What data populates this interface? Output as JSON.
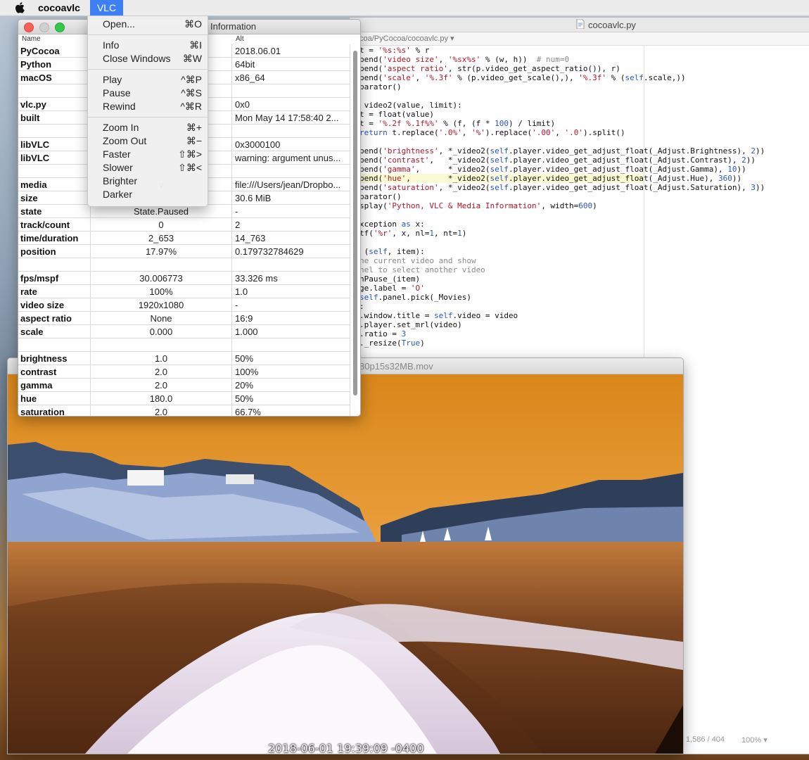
{
  "menubar": {
    "app_name": "cocoavlc",
    "active_menu": "VLC"
  },
  "vlc_menu": {
    "groups": [
      [
        {
          "label": "Open...",
          "shortcut": "⌘O"
        }
      ],
      [
        {
          "label": "Info",
          "shortcut": "⌘I"
        },
        {
          "label": "Close Windows",
          "shortcut": "⌘W"
        }
      ],
      [
        {
          "label": "Play",
          "shortcut": "^⌘P"
        },
        {
          "label": "Pause",
          "shortcut": "^⌘S"
        },
        {
          "label": "Rewind",
          "shortcut": "^⌘R"
        }
      ],
      [
        {
          "label": "Zoom In",
          "shortcut": "⌘+"
        },
        {
          "label": "Zoom Out",
          "shortcut": "⌘−"
        },
        {
          "label": "Faster",
          "shortcut": "⇧⌘>"
        },
        {
          "label": "Slower",
          "shortcut": "⇧⌘<"
        },
        {
          "label": "Brighter",
          "shortcut": ""
        },
        {
          "label": "Darker",
          "shortcut": ""
        }
      ]
    ]
  },
  "info_window": {
    "title": "Information",
    "columns": {
      "name": "Name",
      "alt": "Alt"
    },
    "rows": [
      [
        "PyCocoa",
        "",
        "2018.06.01"
      ],
      [
        "Python",
        "",
        "64bit"
      ],
      [
        "macOS",
        "",
        "x86_64"
      ],
      [
        "",
        "",
        ""
      ],
      [
        "vlc.py",
        "",
        "0x0"
      ],
      [
        "built",
        "",
        "Mon May 14 17:58:40 2..."
      ],
      [
        "",
        "",
        ""
      ],
      [
        "libVLC",
        "",
        "0x3000100"
      ],
      [
        "libVLC",
        "",
        "warning: argument unus..."
      ],
      [
        "",
        "",
        ""
      ],
      [
        "media",
        "v",
        "file:///Users/jean/Dropbo..."
      ],
      [
        "size",
        "",
        "30.6 MiB"
      ],
      [
        "state",
        "State.Paused",
        "-"
      ],
      [
        "track/count",
        "0",
        "2"
      ],
      [
        "time/duration",
        "2_653",
        "14_763"
      ],
      [
        "position",
        "17.97%",
        "0.179732784629"
      ],
      [
        "",
        "",
        ""
      ],
      [
        "fps/mspf",
        "30.006773",
        "33.326 ms"
      ],
      [
        "rate",
        "100%",
        "1.0"
      ],
      [
        "video size",
        "1920x1080",
        "-"
      ],
      [
        "aspect ratio",
        "None",
        "16:9"
      ],
      [
        "scale",
        "0.000",
        "1.000"
      ],
      [
        "",
        "",
        ""
      ],
      [
        "brightness",
        "1.0",
        "50%"
      ],
      [
        "contrast",
        "2.0",
        "100%"
      ],
      [
        "gamma",
        "2.0",
        "20%"
      ],
      [
        "hue",
        "180.0",
        "50%"
      ],
      [
        "saturation",
        "2.0",
        "66.7%"
      ]
    ]
  },
  "editor": {
    "title": "cocoavlc.py",
    "path": "coa/PyCocoa/cocoavlc.py",
    "status_position": "1,586 / 404",
    "status_zoom": "100%"
  },
  "video_window": {
    "title": "80p15s32MB.mov",
    "timestamp": "2018-06-01 19:39:09 -0400"
  },
  "colors": {
    "accent": "#3d7ff5",
    "sky_orange": "#e8951e",
    "water": "#6b3d1a"
  }
}
